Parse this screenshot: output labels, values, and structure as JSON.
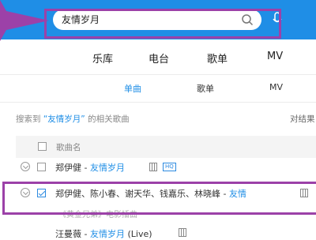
{
  "search": {
    "value": "友情岁月"
  },
  "main_tabs": [
    "乐库",
    "电台",
    "歌单",
    "MV"
  ],
  "sub_tabs": [
    "单曲",
    "歌单",
    "MV"
  ],
  "results": {
    "prefix": "搜索到",
    "query": "“友情岁月”",
    "suffix": "的相关歌曲",
    "paired_button": "对结果"
  },
  "column": {
    "song_name": "歌曲名"
  },
  "rows": [
    {
      "artist": "郑伊健 - ",
      "title": "友情岁月",
      "badge": "HQ"
    },
    {
      "artist": "郑伊健、陈小春、谢天华、钱嘉乐、林晓峰 - ",
      "title": "友情",
      "sub": "《黄金兄弟》电影插曲"
    },
    {
      "artist": "汪曼薇 - ",
      "title": "友情岁月",
      "suffix": " (Live)"
    }
  ],
  "colors": {
    "brand": "#1f8ee6",
    "highlight": "#9c41a8"
  }
}
